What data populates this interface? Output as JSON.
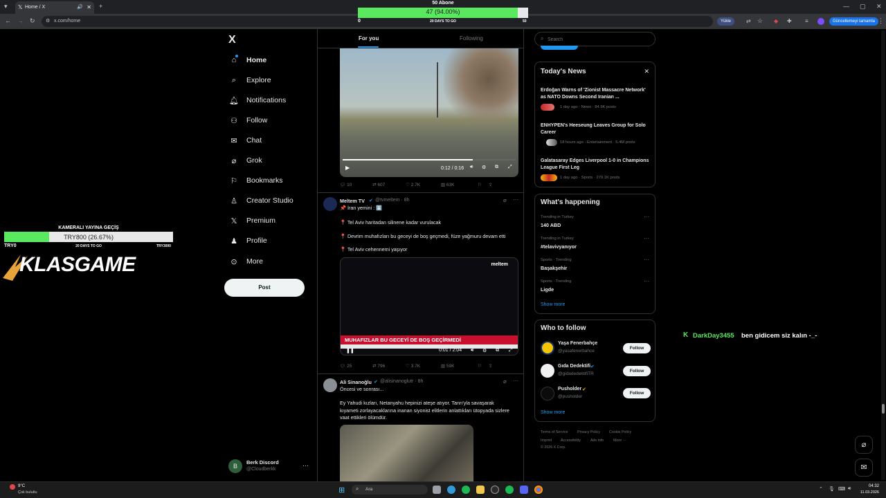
{
  "browser": {
    "tab_title": "Home / X",
    "url": "x.com/home",
    "upload_label": "Yükle",
    "update_label": "Güncellemeyi tamamla"
  },
  "sub_goal": {
    "title": "50 Abone",
    "progress_text": "47 (94.00%)",
    "progress": 0.94,
    "start": "0",
    "days": "20 DAYS TO GO",
    "end": "50"
  },
  "donation_goal": {
    "title": "KAMERALI YAYINA GEÇİŞ",
    "progress_text": "TRY800 (26.67%)",
    "progress": 0.2667,
    "start": "TRY0",
    "days": "20 DAYS TO GO",
    "end": "TRY3000"
  },
  "sponsor_logo": "KLASGAME",
  "chat_overlay": {
    "user": "DarkDay3455",
    "message": "ben gidicem siz kalın -_-",
    "color": "#59e85e"
  },
  "nav": {
    "logo": "X",
    "items": [
      "Home",
      "Explore",
      "Notifications",
      "Follow",
      "Chat",
      "Grok",
      "Bookmarks",
      "Creator Studio",
      "Premium",
      "Profile",
      "More"
    ],
    "post_label": "Post"
  },
  "account": {
    "initial": "B",
    "name": "Berk Discord",
    "handle": "@Cloudberkk"
  },
  "feed_tabs": {
    "for_you": "For you",
    "following": "Following"
  },
  "tweet1": {
    "time": "0:12 / 0:16",
    "reply": "10",
    "retweet": "607",
    "like": "2.7K",
    "views": "63K"
  },
  "tweet2": {
    "name": "Meltem TV",
    "handle": "@tvmeltem · 8h",
    "line1": "📌 İran yemini : ⬇️",
    "line2": "📍 Tel Aviv haritadan silinene kadar vurulacak",
    "line3": "📍 Devrim muhafızları bu geceyi de boş geçmedi, füze yağmuru devam etti",
    "line4": "📍 Tel Aviv cehennemi yaşıyor",
    "video_brand": "meltem",
    "video_headline": "MUHAFIZLAR BU GECEYİ DE BOŞ GEÇİRMEDİ",
    "time": "0:01 / 2:04",
    "reply": "25",
    "retweet": "796",
    "like": "3.7K",
    "views": "59K"
  },
  "tweet3": {
    "name": "Ali Sinanoğlu",
    "handle": "@alisinanoglutr · 8h",
    "line1": "Öncesi ve sonrası...",
    "body": "Ey Yahudi kızları, Netanyahu hepinizi ateşe atıyor. Tanrı'yla savaşarak kıyameti zorlayacaklarına inanan siyonist elitlerin anlattıkları ütopyada sizlere vaat ettikleri ölümdür."
  },
  "search": {
    "placeholder": "Search"
  },
  "news": {
    "title": "Today's News",
    "items": [
      {
        "headline": "Erdoğan Warns of 'Zionist Massacre Network' as NATO Downs Second Iranian ...",
        "meta": "1 day ago · News · 84.9K posts"
      },
      {
        "headline": "ENHYPEN's Heeseung Leaves Group for Solo Career",
        "meta": "18 hours ago · Entertainment · 5.4M posts"
      },
      {
        "headline": "Galatasaray Edges Liverpool 1-0 in Champions League First Leg",
        "meta": "1 day ago · Sports · 279.1K posts"
      }
    ]
  },
  "happening": {
    "title": "What's happening",
    "items": [
      {
        "context": "Trending in Turkey",
        "name": "140 ABD"
      },
      {
        "context": "Trending in Turkey",
        "name": "#telavivyanıyor"
      },
      {
        "context": "Sports · Trending",
        "name": "Başakşehir"
      },
      {
        "context": "Sports · Trending",
        "name": "Ligde"
      }
    ],
    "show_more": "Show more"
  },
  "who_to_follow": {
    "title": "Who to follow",
    "items": [
      {
        "name": "Yaşa Fenerbahçe",
        "handle": "@yasafenerbahce"
      },
      {
        "name": "Gıda Dedektifi",
        "handle": "@gidadedektifiTR"
      },
      {
        "name": "Pusholder",
        "handle": "@pusholder"
      }
    ],
    "follow_label": "Follow",
    "show_more": "Show more"
  },
  "footer": {
    "links": [
      "Terms of Service",
      "Privacy Policy",
      "Cookie Policy",
      "Imprint",
      "Accessibility",
      "Ads info",
      "More ···"
    ],
    "copyright": "© 2026 X Corp."
  },
  "taskbar": {
    "weather_temp": "9°C",
    "weather_desc": "Çok bulutlu",
    "search_label": "Ara",
    "time": "04:32",
    "date": "11.03.2026"
  },
  "colors": {
    "accent": "#1d9bf0",
    "goal_green": "#59e85e"
  }
}
